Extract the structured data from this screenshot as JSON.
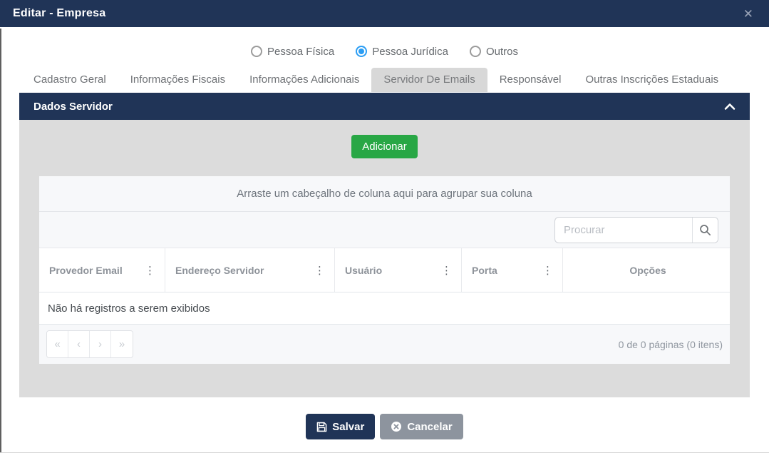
{
  "modal": {
    "title": "Editar - Empresa",
    "close_glyph": "✕"
  },
  "person_type": {
    "options": [
      {
        "label": "Pessoa Física",
        "selected": false
      },
      {
        "label": "Pessoa Jurídica",
        "selected": true
      },
      {
        "label": "Outros",
        "selected": false
      }
    ]
  },
  "tabs": {
    "items": [
      "Cadastro Geral",
      "Informações Fiscais",
      "Informações Adicionais",
      "Servidor De Emails",
      "Responsável",
      "Outras Inscrições Estaduais"
    ],
    "active": "Servidor De Emails"
  },
  "panel": {
    "title": "Dados Servidor",
    "add_button": "Adicionar"
  },
  "grid": {
    "group_hint": "Arraste um cabeçalho de coluna aqui para agrupar sua coluna",
    "search_placeholder": "Procurar",
    "columns": [
      "Provedor Email",
      "Endereço Servidor",
      "Usuário",
      "Porta",
      "Opções"
    ],
    "column_menu_glyph": "⋮",
    "empty_message": "Não há registros a serem exibidos",
    "pager": {
      "first": "«",
      "prev": "‹",
      "next": "›",
      "last": "»",
      "summary": "0 de 0 páginas (0 itens)"
    }
  },
  "footer": {
    "save_label": "Salvar",
    "cancel_label": "Cancelar"
  },
  "colors": {
    "header_navy": "#203457",
    "add_green": "#28a745",
    "cancel_gray": "#8d949e",
    "radio_blue": "#2a9df4",
    "panel_body_gray": "#dcdcdc"
  }
}
